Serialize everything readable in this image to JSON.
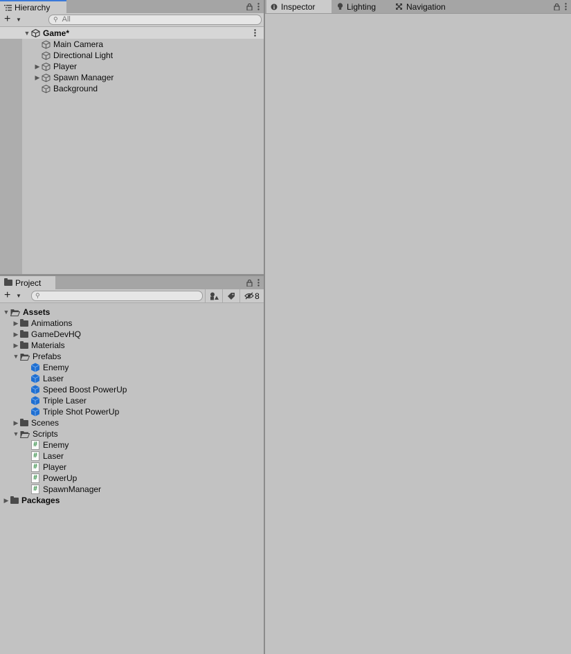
{
  "hierarchy": {
    "tab_label": "Hierarchy",
    "search_placeholder": "All",
    "scene_name": "Game*",
    "items": [
      {
        "label": "Main Camera",
        "expandable": false
      },
      {
        "label": "Directional Light",
        "expandable": false
      },
      {
        "label": "Player",
        "expandable": true
      },
      {
        "label": "Spawn Manager",
        "expandable": true
      },
      {
        "label": "Background",
        "expandable": false
      }
    ]
  },
  "project": {
    "tab_label": "Project",
    "search_placeholder": "",
    "hidden_count": "8",
    "tree": {
      "assets_label": "Assets",
      "folders": {
        "animations": "Animations",
        "gamedevhq": "GameDevHQ",
        "materials": "Materials",
        "prefabs": "Prefabs",
        "scenes": "Scenes",
        "scripts": "Scripts"
      },
      "prefabs": [
        "Enemy",
        "Laser",
        "Speed Boost PowerUp",
        "Triple Laser",
        "Triple Shot PowerUp"
      ],
      "scripts": [
        "Enemy",
        "Laser",
        "Player",
        "PowerUp",
        "SpawnManager"
      ],
      "packages_label": "Packages"
    }
  },
  "right_tabs": {
    "inspector": "Inspector",
    "lighting": "Lighting",
    "navigation": "Navigation"
  },
  "colors": {
    "panel_bg": "#c2c2c2",
    "tabstrip_bg": "#a5a5a5",
    "active_tab_accent": "#3a79d9",
    "prefab_blue": "#1f6fd1",
    "script_green": "#2b8a3e"
  }
}
